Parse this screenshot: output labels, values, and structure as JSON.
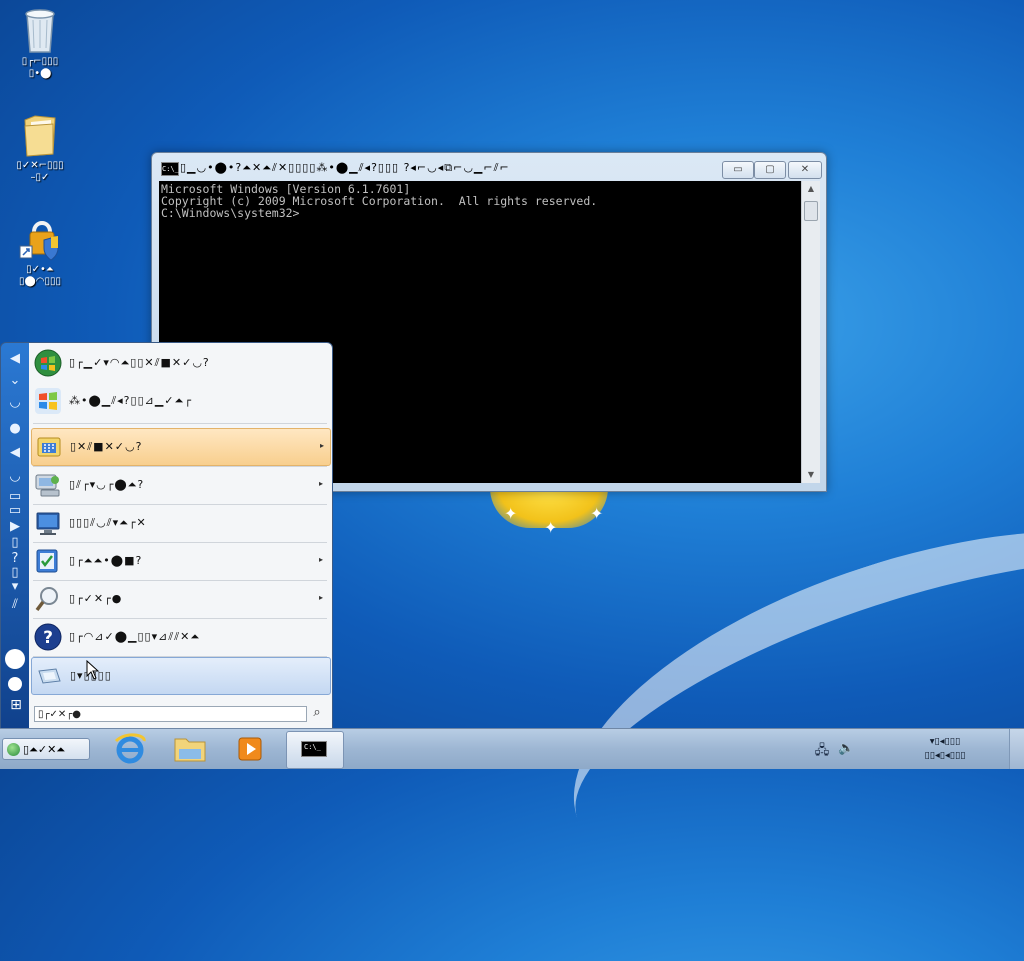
{
  "desktop": {
    "icons": [
      {
        "name": "recycle-bin",
        "label_line1": "▯┌⌐▯▯▯",
        "label_line2": "▯•⬤"
      },
      {
        "name": "folder",
        "label_line1": "▯✓✕⌐▯▯▯",
        "label_line2": "–▯✓"
      },
      {
        "name": "security-shortcut",
        "label_line1": "▯✓•⏶",
        "label_line2": "▯⬤◠▯▯▯"
      }
    ]
  },
  "cmd_window": {
    "title": "▯▁◡•⬤•?⏶✕⏶⫽✕▯▯▯▯⁂•⬤▁⫽◂?▯▯▯ ?◂⌐◡◂⧉⌐◡▁⌐⫽⌐",
    "icon_text": "C:\\_",
    "min_symbol": "▭",
    "max_symbol": "▢",
    "close_symbol": "✕",
    "console_lines": [
      "Microsoft Windows [Version 6.1.7601]",
      "Copyright (c) 2009 Microsoft Corporation.  All rights reserved.",
      "",
      "C:\\Windows\\system32>"
    ]
  },
  "start_menu": {
    "strip_glyphs": [
      "◀",
      "⌄",
      "◡",
      "●",
      "◀",
      "◡",
      "▭",
      "▭",
      "▶",
      "▯",
      "?",
      "▯",
      "▾",
      "⫽"
    ],
    "items": [
      {
        "name": "windows-update",
        "label": "▯┌▁✓▾◠⏶▯▯✕⫽■✕✓◡?",
        "has_arrow": false
      },
      {
        "name": "windows-anytime-upgrade",
        "label": "⁂•⬤▁⫽◂?▯▯⊿▁✓⏶┌",
        "has_arrow": false
      },
      {
        "name": "programs",
        "label": "▯✕⫽■✕✓◡?",
        "has_arrow": true
      },
      {
        "name": "documents",
        "label": "▯⫽┌▾◡┌⬤⏶?",
        "has_arrow": true
      },
      {
        "name": "settings",
        "label": "▯▯▯⫽◡⫽▾⏶┌✕",
        "has_arrow": false
      },
      {
        "name": "settings-2",
        "label": "▯┌⏶⏶•⬤■?",
        "has_arrow": true
      },
      {
        "name": "search",
        "label": "▯┌✓✕┌●",
        "has_arrow": true
      },
      {
        "name": "help",
        "label": "▯┌◠⊿✓⬤▁▯▯▾⊿⫽⫽✕⏶",
        "has_arrow": false
      },
      {
        "name": "run",
        "label": "▯▾▯▯▯▯",
        "has_arrow": false
      }
    ],
    "arrow_symbol": "▸",
    "search_placeholder": "▯┌✓✕┌●",
    "search_glyph": "⌕"
  },
  "taskbar": {
    "start_label": "▯⏶✓✕⏶",
    "apps": [
      "internet-explorer",
      "windows-explorer",
      "media-player",
      "command-prompt"
    ],
    "cmd_icon_text": "C:\\_",
    "clock_line1": "▾▯◂▯▯▯",
    "clock_line2": "▯▯◂▯◂▯▯▯"
  },
  "colors": {
    "taskbar": "#9db6d3",
    "start_strip": "#1c5fb3",
    "highlight": "#f8cf8e",
    "selected": "#c4d8f2"
  }
}
